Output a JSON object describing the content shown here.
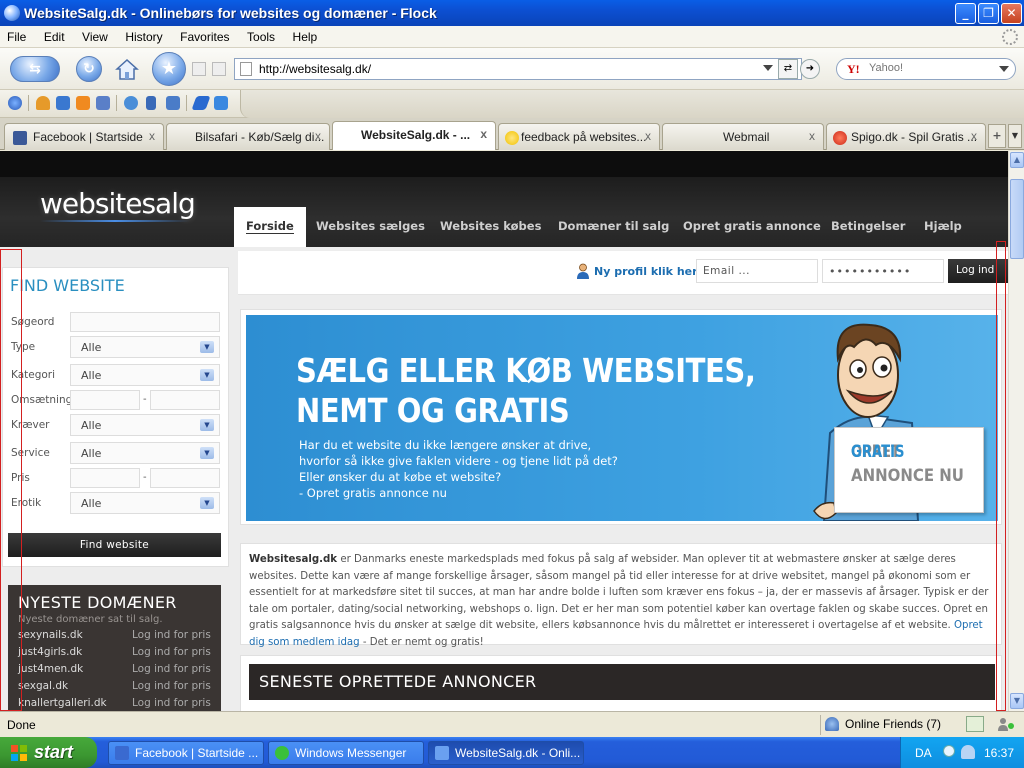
{
  "window": {
    "title": "WebsiteSalg.dk - Onlinebørs for websites og domæner - Flock",
    "minimize": "_",
    "maximize": "❐",
    "close": "✕"
  },
  "menu": [
    "File",
    "Edit",
    "View",
    "History",
    "Favorites",
    "Tools",
    "Help"
  ],
  "address": {
    "url": "http://websitesalg.dk/",
    "search_placeholder": "Yahoo!",
    "search_logo": "Y!"
  },
  "tabs": [
    {
      "label": "Facebook | Startside",
      "close": "x",
      "favicon_color": "#3b5998"
    },
    {
      "label": "Bilsafari - Køb/Sælg di...",
      "close": "x",
      "favicon_color": ""
    },
    {
      "label": "WebsiteSalg.dk - ...",
      "close": "x",
      "favicon_color": ""
    },
    {
      "label": "feedback på websites...",
      "close": "x",
      "favicon_color": "#f2c200"
    },
    {
      "label": "Webmail",
      "close": "x",
      "favicon_color": ""
    },
    {
      "label": "Spigo.dk - Spil Gratis ...",
      "close": "x",
      "favicon_color": "#cc2a1a"
    }
  ],
  "tab_add": "+",
  "site": {
    "logo": "websitesalg",
    "nav": [
      "Forside",
      "Websites sælges",
      "Websites købes",
      "Domæner til salg",
      "Opret gratis annonce",
      "Betingelser",
      "Hjælp"
    ],
    "profile_link": "Ny profil klik her",
    "email_placeholder": "Email ...",
    "password_mask": "•••••••••••",
    "login_button": "Log ind",
    "find": {
      "title": "FIND WEBSITE",
      "labels": {
        "sogeord": "Søgeord",
        "type": "Type",
        "kategori": "Kategori",
        "omsaetning": "Omsætning",
        "kraever": "Kræver",
        "service": "Service",
        "pris": "Pris",
        "erotik": "Erotik"
      },
      "select_value": "Alle",
      "range_sep": "-",
      "button": "Find website"
    },
    "newest": {
      "title": "NYESTE DOMÆNER",
      "subtitle": "Nyeste domæner sat til salg.",
      "items": [
        {
          "domain": "sexynails.dk",
          "price": "Log ind for pris"
        },
        {
          "domain": "just4girls.dk",
          "price": "Log ind for pris"
        },
        {
          "domain": "just4men.dk",
          "price": "Log ind for pris"
        },
        {
          "domain": "sexgal.dk",
          "price": "Log ind for pris"
        },
        {
          "domain": "knallertgalleri.dk",
          "price": "Log ind for pris"
        }
      ]
    },
    "banner": {
      "headline1": "SÆLG ELLER KØB WEBSITES,",
      "headline2": "NEMT OG GRATIS",
      "lines": [
        "Har du et website du ikke længere ønsker at drive,",
        "hvorfor så ikke give faklen videre - og tjene lidt på det?",
        "Eller ønsker du at købe et website?",
        "- Opret gratis annonce nu"
      ],
      "sign_line1_a": "OPRET ",
      "sign_line1_b": "GRATIS",
      "sign_line2": "ANNONCE NU"
    },
    "description": {
      "brand": "Websitesalg.dk",
      "text": " er Danmarks eneste markedsplads med fokus på salg af websider. Man oplever tit at webmastere ønsker at sælge deres websites. Dette kan være af mange forskellige årsager, såsom mangel på tid eller interesse for at drive websitet, mangel på økonomi som er essentielt for at markedsføre sitet til succes, at man har andre bolde i luften som kræver ens fokus – ja, der er massevis af årsager. Typisk er der tale om portaler, dating/social networking, webshops o. lign. Det er her man som potentiel køber kan overtage faklen og skabe succes. Opret en gratis salgsannonce hvis du ønsker at sælge dit website, ellers købsannonce hvis du målrettet er interesseret i overtagelse af et website. ",
      "link": "Opret dig som medlem idag",
      "tail": " - Det er nemt og gratis!"
    },
    "latest_title": "SENESTE OPRETTEDE ANNONCER"
  },
  "status": {
    "text": "Done",
    "friends": "Online Friends",
    "friends_count": "(7)"
  },
  "taskbar": {
    "start": "start",
    "tasks": [
      "Facebook | Startside ...",
      "Windows Messenger",
      "WebsiteSalg.dk - Onli..."
    ],
    "lang": "DA",
    "clock": "16:37"
  }
}
